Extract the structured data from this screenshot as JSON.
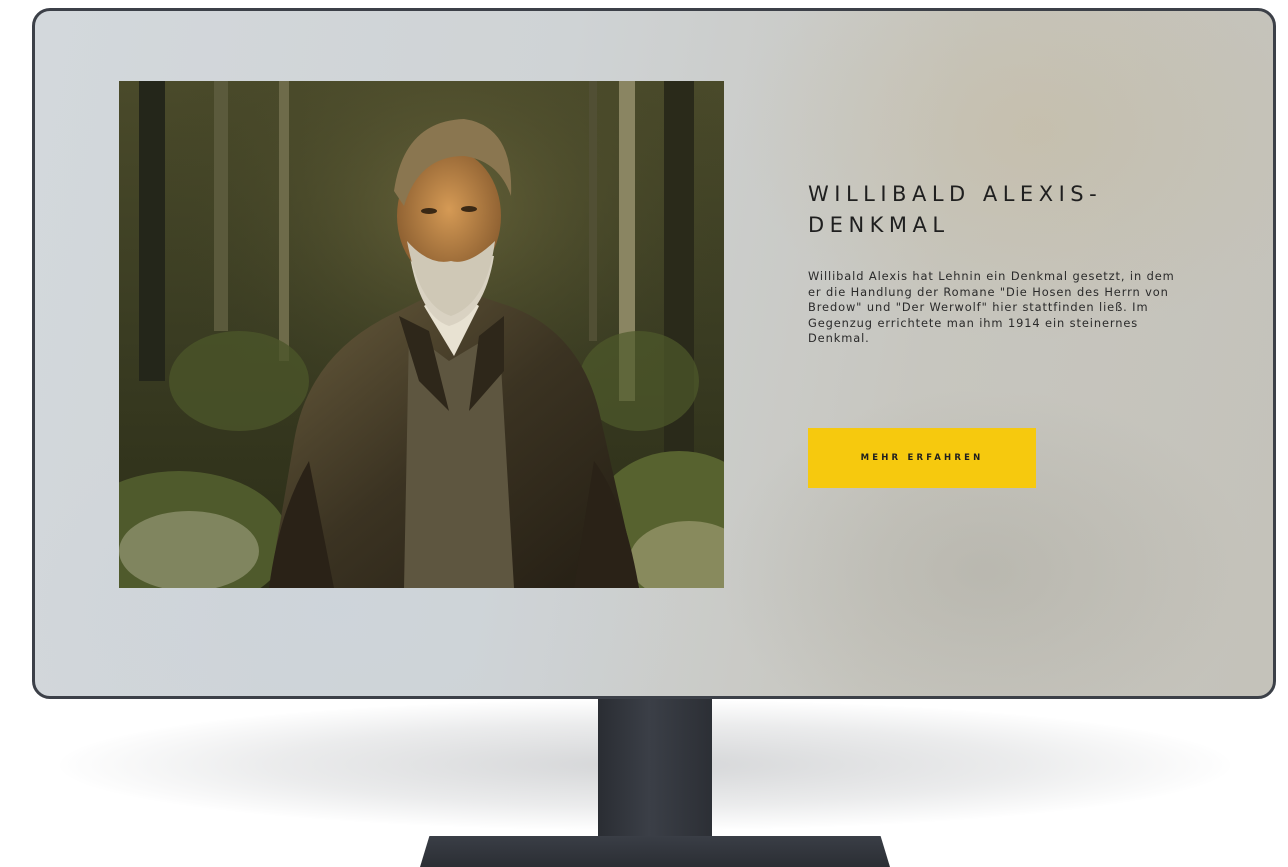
{
  "section": {
    "title": "WILLIBALD ALEXIS-DENKMAL",
    "description": "Willibald Alexis hat Lehnin ein Denkmal gesetzt, in dem er die Handlung der Romane \"Die Hosen des Herrn von Bredow\" und \"Der Werwolf\" hier stattfinden ließ. Im Gegenzug errichtete man ihm 1914 ein steinernes Denkmal.",
    "cta_label": "MEHR ERFAHREN",
    "image_icon": "portrait-painting"
  },
  "colors": {
    "accent": "#f6c90e",
    "text": "#1f1f1f",
    "bezel": "#3c4048",
    "stand": "#2f3238"
  }
}
